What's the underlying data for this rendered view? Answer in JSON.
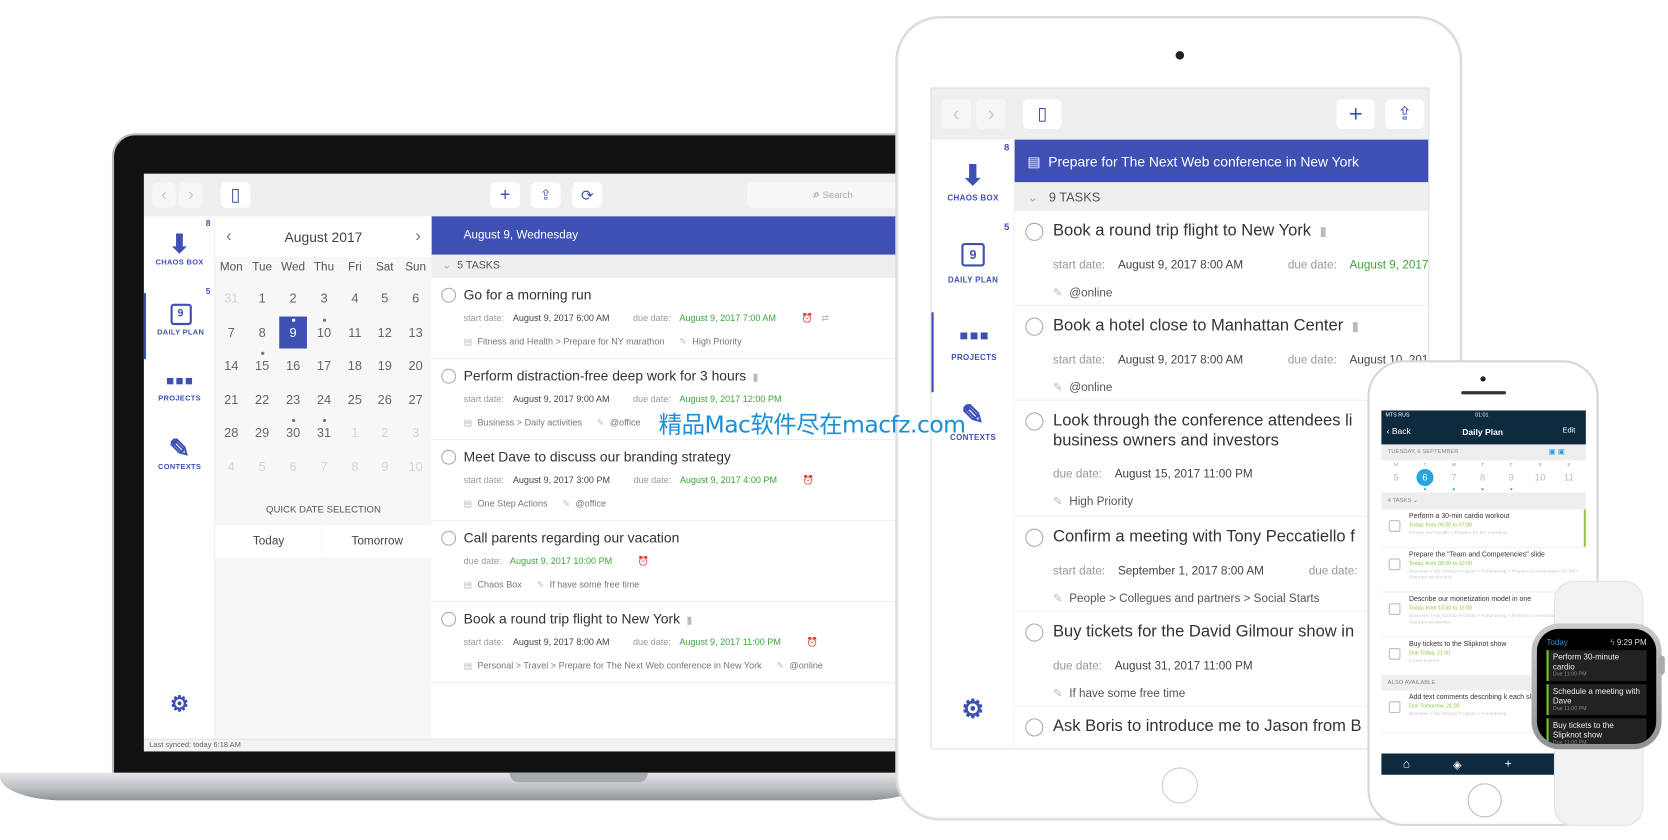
{
  "colors": {
    "accent": "#3e50b4",
    "green": "#3aa53a",
    "phone_bar": "#0d2a3f",
    "watermark": "#1a8fd6"
  },
  "watermark": "精品Mac软件尽在macfz.com",
  "desktop": {
    "search_placeholder": "Search",
    "sidebar": [
      {
        "label": "CHAOS BOX",
        "badge": "8",
        "icon": "inbox-icon"
      },
      {
        "label": "DAILY PLAN",
        "badge": "5",
        "icon": "calendar-icon",
        "active": true
      },
      {
        "label": "PROJECTS",
        "icon": "grid-icon"
      },
      {
        "label": "CONTEXTS",
        "icon": "pin-icon"
      }
    ],
    "calendar": {
      "month": "August 2017",
      "weekdays": [
        "Mon",
        "Tue",
        "Wed",
        "Thu",
        "Fri",
        "Sat",
        "Sun"
      ],
      "days": [
        [
          "31",
          "1",
          "2",
          "3",
          "4",
          "5",
          "6"
        ],
        [
          "7",
          "8",
          "9",
          "10",
          "11",
          "12",
          "13"
        ],
        [
          "14",
          "15",
          "16",
          "17",
          "18",
          "19",
          "20"
        ],
        [
          "21",
          "22",
          "23",
          "24",
          "25",
          "26",
          "27"
        ],
        [
          "28",
          "29",
          "30",
          "31",
          "1",
          "2",
          "3"
        ],
        [
          "4",
          "5",
          "6",
          "7",
          "8",
          "9",
          "10"
        ]
      ],
      "selected": "9",
      "dots": [
        "9",
        "10",
        "15",
        "30",
        "31"
      ]
    },
    "quick_date_title": "QUICK DATE SELECTION",
    "quick_buttons": [
      "Today",
      "Tomorrow"
    ],
    "last_synced": "Last synced: today 6:18 AM",
    "header": "August 9, Wednesday",
    "group": "5 TASKS",
    "start_label": "start date:",
    "due_label": "due date:",
    "tasks": [
      {
        "title": "Go for a morning run",
        "start": "August 9, 2017 6:00 AM",
        "due": "August 9, 2017 7:00 AM",
        "project": "Fitness and Health > Prepare for NY marathon",
        "context": "High Priority",
        "alarm": true,
        "repeat": true
      },
      {
        "title": "Perform distraction-free deep work for 3 hours",
        "note": true,
        "start": "August 9, 2017 9:00 AM",
        "due": "August 9, 2017 12:00 PM",
        "project": "Business > Daily activities",
        "context": "@office"
      },
      {
        "title": "Meet Dave to discuss our branding strategy",
        "start": "August 9, 2017 3:00 PM",
        "due": "August 9, 2017 4:00 PM",
        "project": "One Step Actions",
        "context": "@office",
        "alarm": true
      },
      {
        "title": "Call parents regarding our vacation",
        "due": "August 9, 2017 10:00 PM",
        "project": "Chaos Box",
        "context": "If have some free time",
        "alarm": true
      },
      {
        "title": "Book a round trip flight to New York",
        "note": true,
        "start": "August 9, 2017 8:00 AM",
        "due": "August 9, 2017 11:00 PM",
        "project": "Personal > Travel > Prepare for The Next Web conference in New York",
        "context": "@online",
        "alarm": true
      }
    ]
  },
  "tablet": {
    "sidebar": [
      {
        "label": "CHAOS BOX",
        "badge": "8"
      },
      {
        "label": "DAILY PLAN",
        "badge": "5"
      },
      {
        "label": "PROJECTS",
        "active": true
      },
      {
        "label": "CONTEXTS"
      }
    ],
    "header": "Prepare for The Next Web conference in New York",
    "group": "9 TASKS",
    "start_label": "start date:",
    "due_label": "due date:",
    "tasks": [
      {
        "title": "Book a round trip flight to New York",
        "note": true,
        "start": "August 9, 2017 8:00 AM",
        "due": "August 9, 2017",
        "due_green": true,
        "context": "@online"
      },
      {
        "title": "Book a hotel close to Manhattan Center",
        "note": true,
        "start": "August 9, 2017 8:00 AM",
        "due": "August 10, 2017",
        "context": "@online"
      },
      {
        "title": "Look through the conference attendees li",
        "title2": "business owners and investors",
        "due": "August 15, 2017 11:00 PM",
        "context": "High Priority"
      },
      {
        "title": "Confirm a meeting with Tony Peccatiello f",
        "start": "September 1, 2017 8:00 AM",
        "due": "Se",
        "context": "People > Collegues and partners > Social Starts"
      },
      {
        "title": "Buy tickets for the David Gilmour show in",
        "due": "August 31, 2017 11:00 PM",
        "context": "If have some free time"
      },
      {
        "title": "Ask Boris to introduce me to Jason from B"
      }
    ]
  },
  "phone": {
    "carrier": "MTS RUS",
    "time": "01:01",
    "back": "Back",
    "title": "Daily Plan",
    "edit": "Edit",
    "date": "TUESDAY, 6 SEPTEMBER",
    "week_letters": [
      "M",
      "T",
      "W",
      "T",
      "F",
      "S",
      "S"
    ],
    "week_days": [
      "5",
      "6",
      "7",
      "8",
      "9",
      "10",
      "11"
    ],
    "selected": "6",
    "group": "4 TASKS",
    "tasks": [
      {
        "title": "Perform a 30-min cardio workout",
        "when": "Today, from 06:00 to 07:00",
        "path": "Fitness and Health > Prepare for NY marathon"
      },
      {
        "title": "Prepare the \"Team and Competencies\" slide",
        "when": "Today, from 09:00 to 10:00",
        "path": "Business > My Startup Projects > Fundraising > Prepare a presentation for 500 Startups accelerator"
      },
      {
        "title": "Describe our monetization model in one",
        "when": "Today, from 10:30 to 12:00",
        "path": "Business > My Startup Projects > Fundraising > Prepare a presentation for 500 Startups accelerator"
      },
      {
        "title": "Buy tickets to the Slipknot show",
        "when": "Due Today, 21:00",
        "path": "1-step actions"
      }
    ],
    "also": "ALSO AVAILABLE",
    "also_tasks": [
      {
        "title": "Add text comments describing k each slide",
        "when": "Due Tomorrow, 21:00",
        "path": "Business > My Startup Projects > Fundraising"
      }
    ]
  },
  "watch": {
    "title": "Today",
    "time": "9:29 PM",
    "items": [
      {
        "title": "Perform 30-minute cardio",
        "due": "Due 11:00 PM"
      },
      {
        "title": "Schedule a meeting with Dave",
        "due": "Due 11:00 PM"
      },
      {
        "title": "Buy tickets to the Slipknot show",
        "due": "Due 11:00 PM"
      }
    ]
  }
}
